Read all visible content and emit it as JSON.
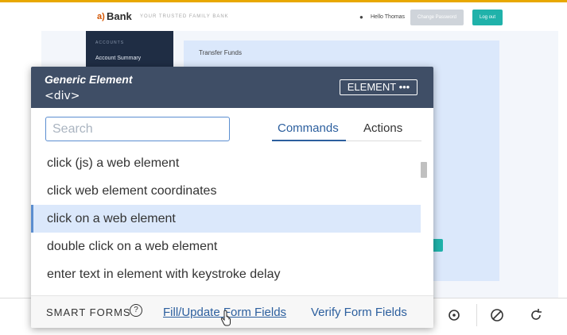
{
  "app": {
    "logo_icon": "a)",
    "logo_text": "Bank",
    "tagline": "YOUR TRUSTED FAMILY BANK",
    "hello": "Hello Thomas",
    "change_password": "Change Password",
    "logout": "Log out",
    "sidebar_section": "ACCOUNTS",
    "sidebar_item": "Account Summary",
    "panel_title": "Transfer Funds"
  },
  "popup": {
    "title": "Generic Element",
    "subtitle": "<div>",
    "badge": "ELEMENT",
    "badge_more": "•••",
    "search_placeholder": "Search",
    "tabs": [
      "Commands",
      "Actions"
    ],
    "active_tab": "Commands",
    "commands": [
      "click (js) a web element",
      "click web element coordinates",
      "click on a web element",
      "double click on a web element",
      "enter text in element with keystroke delay"
    ],
    "selected_index": 2,
    "footer_label": "SMART FORMS",
    "footer_links": [
      "Fill/Update Form Fields",
      "Verify Form Fields"
    ]
  },
  "icons": {
    "help": "question-circle-icon",
    "cursor": "hand-pointer-icon",
    "refresh": "refresh-icon",
    "block": "block-icon",
    "reload": "reload-icon"
  },
  "colors": {
    "header_bg": "#3f4e66",
    "accent_blue": "#2c5f9e",
    "selection_bg": "#dbe8fb",
    "teal": "#20b2aa"
  }
}
